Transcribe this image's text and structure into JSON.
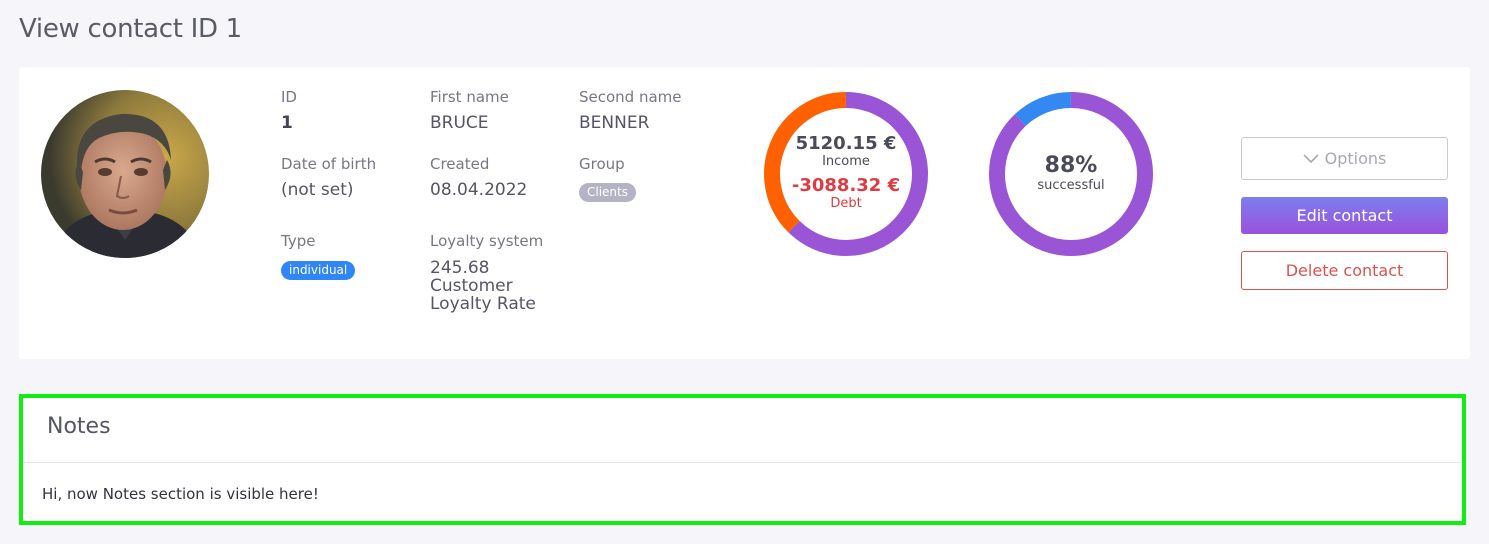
{
  "page": {
    "title": "View contact ID 1"
  },
  "contact": {
    "fields": {
      "id": {
        "label": "ID",
        "value": "1"
      },
      "first_name": {
        "label": "First name",
        "value": "BRUCE"
      },
      "second_name": {
        "label": "Second name",
        "value": "BENNER"
      },
      "date_of_birth": {
        "label": "Date of birth",
        "value": "(not set)"
      },
      "created": {
        "label": "Created",
        "value": "08.04.2022"
      },
      "group": {
        "label": "Group",
        "value": "Clients"
      },
      "type": {
        "label": "Type",
        "value": "individual"
      },
      "loyalty": {
        "label": "Loyalty system",
        "value_lines": [
          "245.68",
          "Customer",
          "Loyalty Rate"
        ]
      }
    },
    "badge_colors": {
      "type": "#2f86f6",
      "group": "#b3b3c4"
    }
  },
  "charts": {
    "income_debt": {
      "income_value": "5120.15 €",
      "income_label": "Income",
      "debt_value": "-3088.32 €",
      "debt_label": "Debt",
      "income_amount": 5120.15,
      "debt_amount": 3088.32,
      "colors": {
        "income": "#9a55d6",
        "debt": "#ff6100",
        "debt_text": "#e03b43"
      }
    },
    "success": {
      "percent_value": "88%",
      "percent_label": "successful",
      "percent": 88,
      "colors": {
        "success": "#9a55d6",
        "rest": "#3488f1"
      }
    }
  },
  "actions": {
    "options_label": "Options",
    "edit_label": "Edit contact",
    "delete_label": "Delete contact"
  },
  "notes": {
    "title": "Notes",
    "body": "Hi, now Notes section is visible here!"
  }
}
